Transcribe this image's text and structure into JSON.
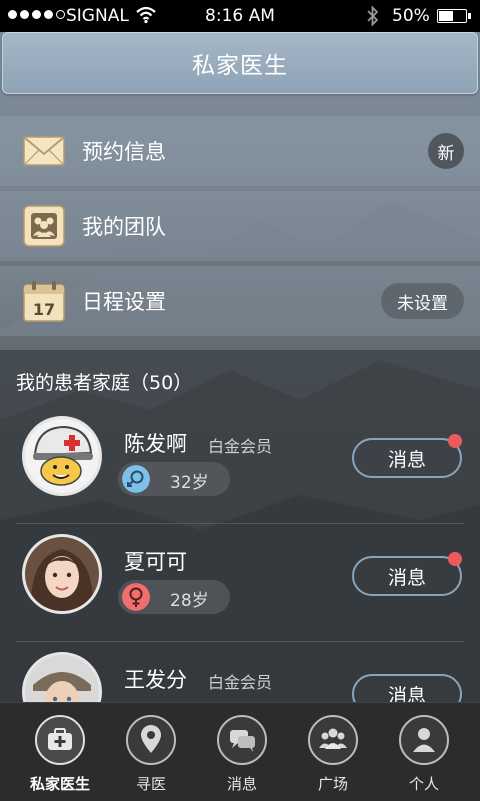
{
  "status_bar": {
    "carrier": "SIGNAL",
    "time": "8:16 AM",
    "battery": "50%"
  },
  "header": {
    "title": "私家医生"
  },
  "menu": [
    {
      "label": "预约信息",
      "icon": "mail-icon",
      "badge": "新"
    },
    {
      "label": "我的团队",
      "icon": "team-icon"
    },
    {
      "label": "日程设置",
      "icon": "calendar-icon",
      "calendar_day": "17",
      "badge": "未设置"
    }
  ],
  "patients": {
    "title": "我的患者家庭（50）",
    "rows": [
      {
        "name": "陈发啊",
        "member": "白金会员",
        "gender": "male",
        "age": "32岁",
        "message": "消息",
        "unread": true
      },
      {
        "name": "夏可可",
        "member": "",
        "gender": "female",
        "age": "28岁",
        "message": "消息",
        "unread": true
      },
      {
        "name": "王发分",
        "member": "白金会员",
        "gender": "",
        "age": "",
        "message": "消息",
        "unread": false
      }
    ]
  },
  "tabs": [
    {
      "label": "私家医生",
      "icon": "medical-kit-icon",
      "active": true
    },
    {
      "label": "寻医",
      "icon": "location-pin-icon",
      "active": false
    },
    {
      "label": "消息",
      "icon": "chat-bubbles-icon",
      "active": false
    },
    {
      "label": "广场",
      "icon": "group-icon",
      "active": false
    },
    {
      "label": "个人",
      "icon": "person-icon",
      "active": false
    }
  ],
  "colors": {
    "male": "#7fc0ea",
    "female": "#f06e6e",
    "unread_dot": "#ee5a5a",
    "button_border": "#8aa4bd"
  }
}
